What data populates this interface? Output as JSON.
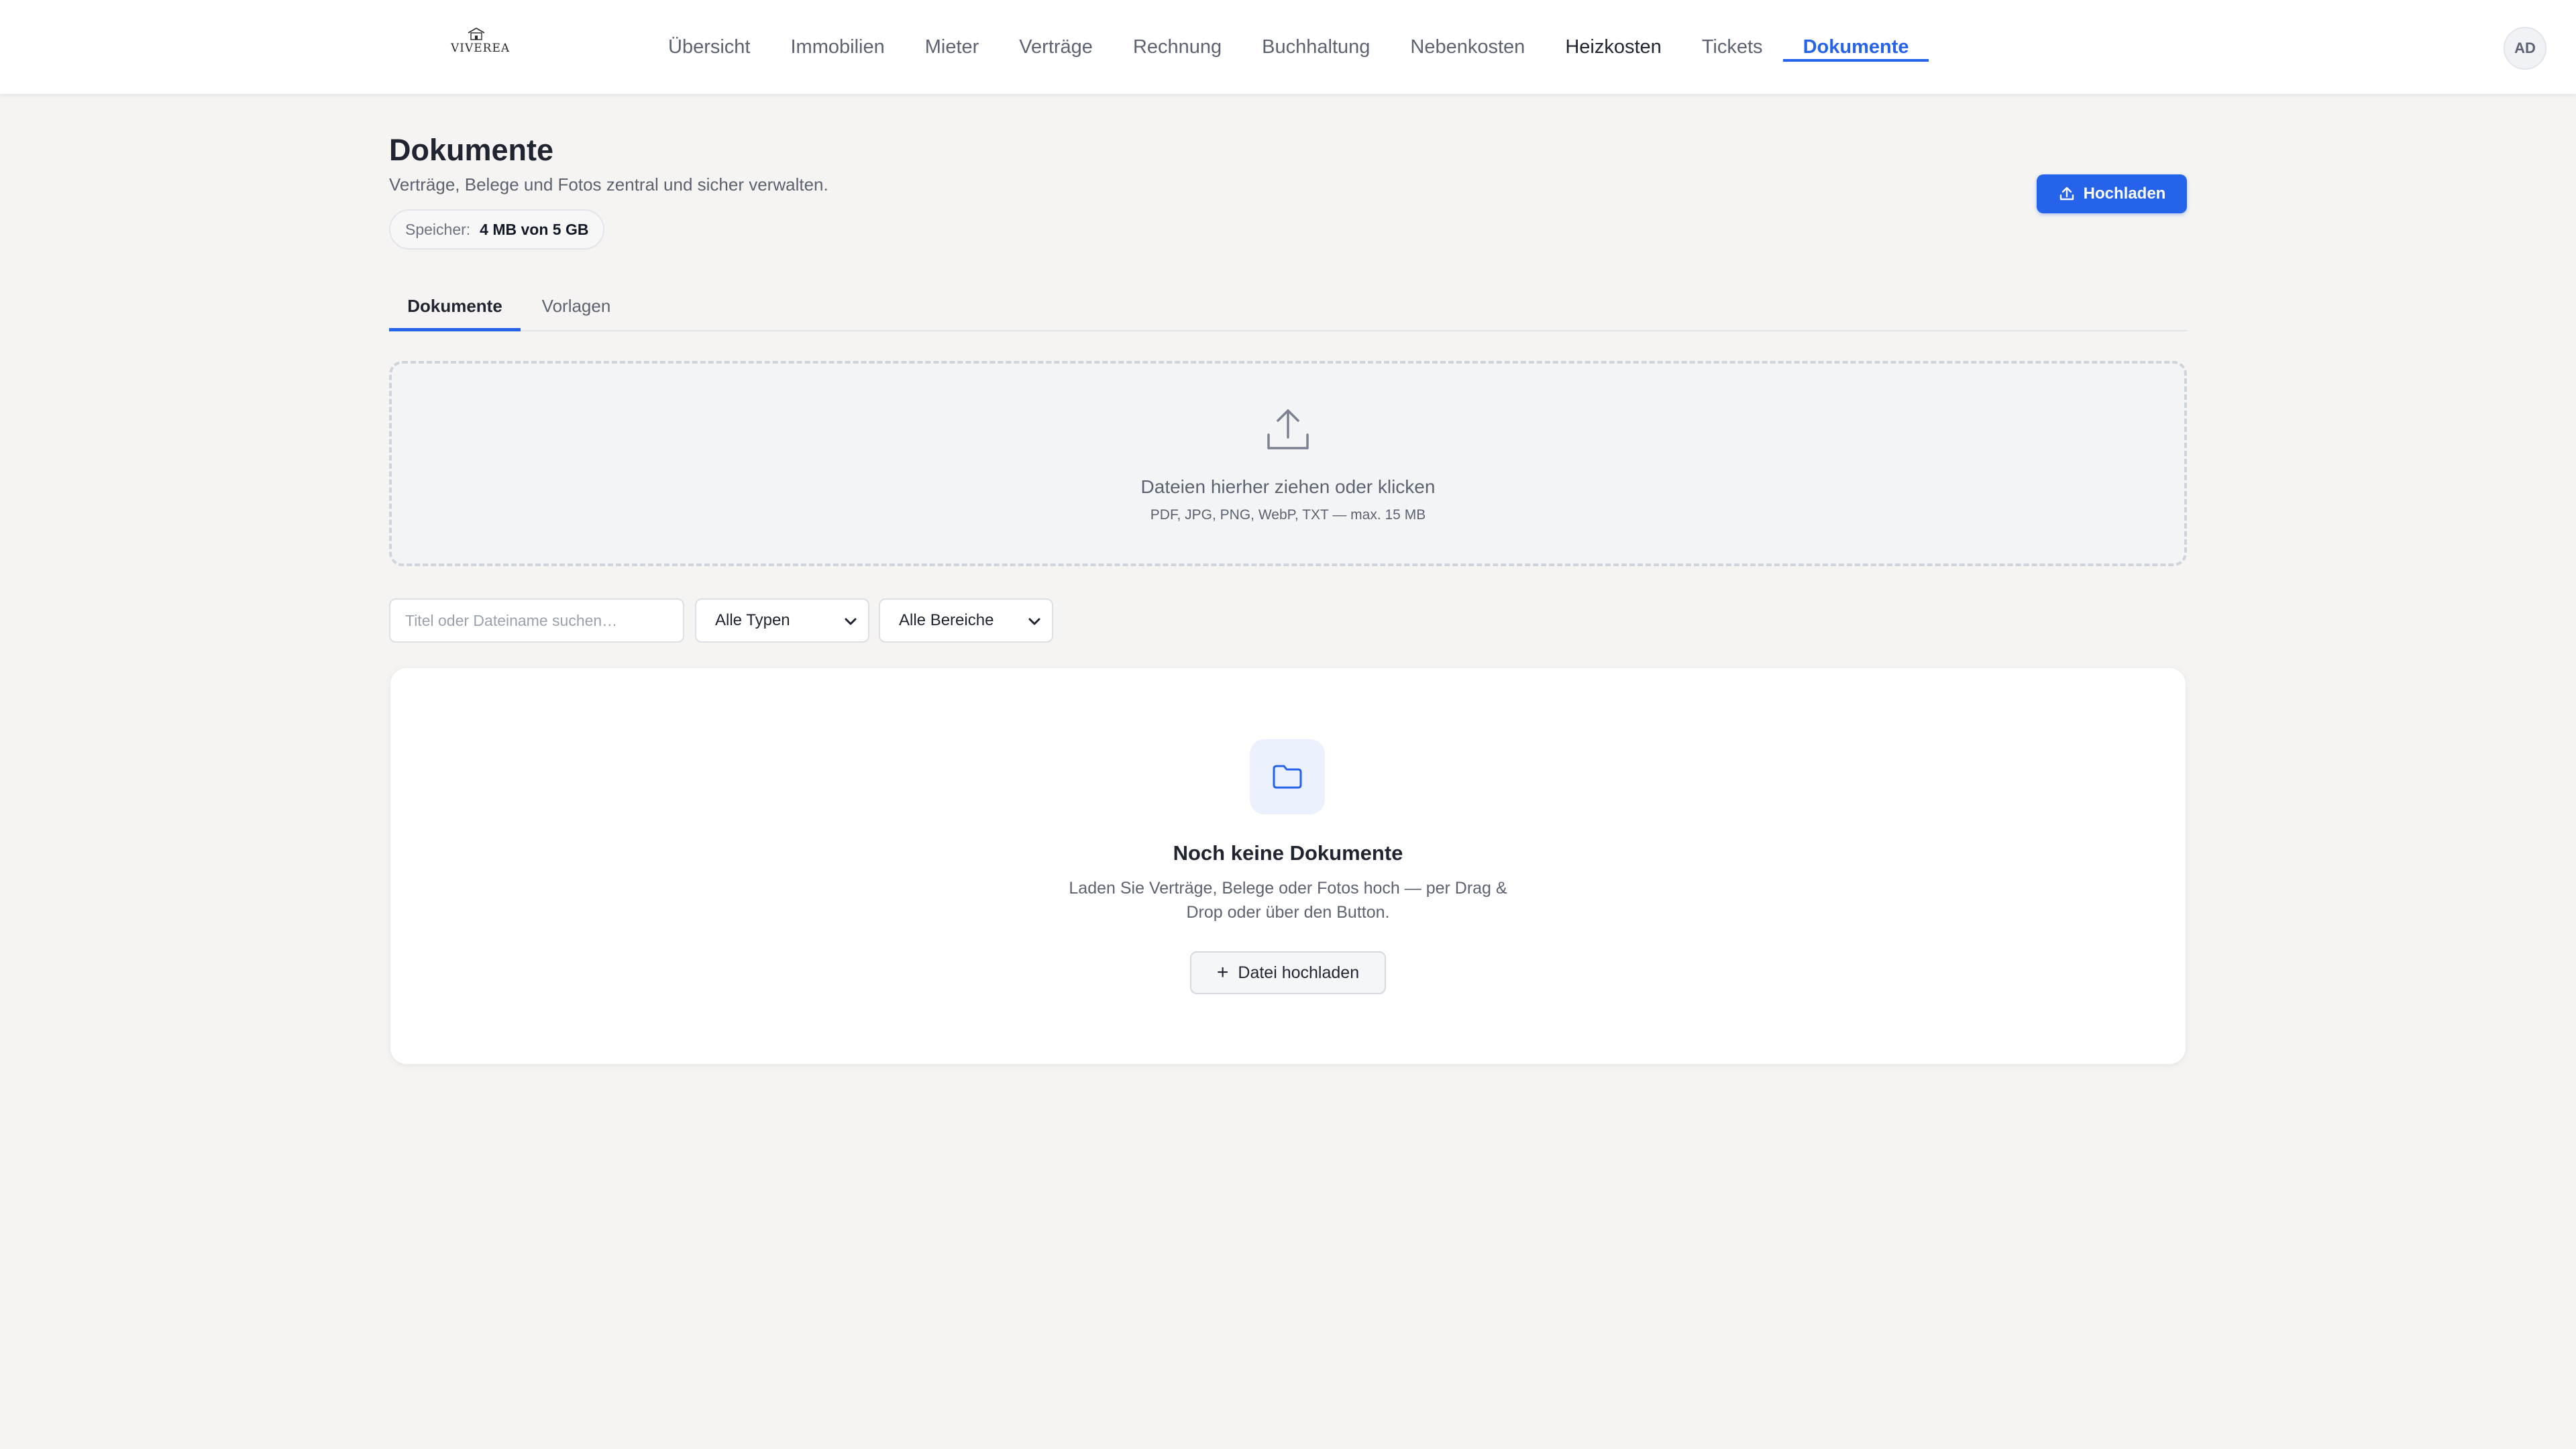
{
  "brand": {
    "name": "VIVEREA"
  },
  "nav": {
    "items": [
      {
        "label": "Übersicht"
      },
      {
        "label": "Immobilien"
      },
      {
        "label": "Mieter"
      },
      {
        "label": "Verträge"
      },
      {
        "label": "Rechnung"
      },
      {
        "label": "Buchhaltung"
      },
      {
        "label": "Nebenkosten"
      },
      {
        "label": "Heizkosten"
      },
      {
        "label": "Tickets"
      },
      {
        "label": "Dokumente"
      }
    ],
    "active": "Dokumente"
  },
  "user": {
    "initials": "AD"
  },
  "header": {
    "title": "Dokumente",
    "subtitle": "Verträge, Belege und Fotos zentral und sicher verwalten.",
    "storage_label": "Speicher:",
    "storage_value": "4 MB von 5 GB",
    "upload_label": "Hochladen"
  },
  "tabs": [
    {
      "label": "Dokumente",
      "active": true
    },
    {
      "label": "Vorlagen",
      "active": false
    }
  ],
  "dropzone": {
    "title": "Dateien hierher ziehen oder klicken",
    "hint": "PDF, JPG, PNG, WebP, TXT — max. 15 MB"
  },
  "filters": {
    "search_placeholder": "Titel oder Dateiname suchen…",
    "type_selected": "Alle Typen",
    "area_selected": "Alle Bereiche"
  },
  "empty_state": {
    "icon": "folder-icon",
    "title": "Noch keine Dokumente",
    "description": "Laden Sie Verträge, Belege oder Fotos hoch — per Drag & Drop oder über den Button.",
    "button_label": "Datei hochladen"
  },
  "colors": {
    "accent": "#2563eb",
    "background": "#f5f4f2",
    "card": "#ffffff"
  }
}
